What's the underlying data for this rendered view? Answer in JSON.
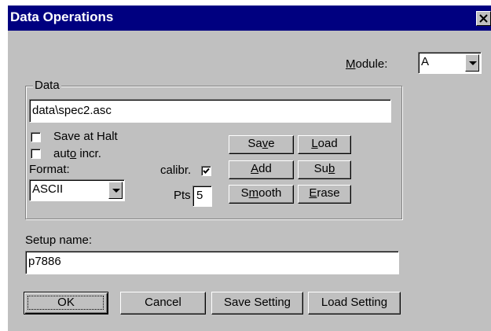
{
  "window": {
    "title": "Data Operations"
  },
  "module": {
    "label": "Module:",
    "value": "A"
  },
  "data_group": {
    "legend": "Data",
    "filename": "data\\spec2.asc",
    "save_at_halt": {
      "label": "Save at Halt",
      "checked": false
    },
    "auto_incr": {
      "label_pre": "aut",
      "label_key": "o",
      "label_post": " incr.",
      "checked": false
    },
    "format": {
      "label": "Format:",
      "value": "ASCII"
    },
    "calibr": {
      "label": "calibr.",
      "checked": true
    },
    "pts": {
      "label": "Pts",
      "value": "5"
    },
    "buttons": {
      "save": {
        "pre": "Sa",
        "key": "v",
        "post": "e"
      },
      "load": {
        "pre": "",
        "key": "L",
        "post": "oad"
      },
      "add": {
        "pre": "",
        "key": "A",
        "post": "dd"
      },
      "sub": {
        "pre": "Su",
        "key": "b",
        "post": ""
      },
      "smooth": {
        "pre": "S",
        "key": "m",
        "post": "ooth"
      },
      "erase": {
        "pre": "",
        "key": "E",
        "post": "rase"
      }
    }
  },
  "setup": {
    "label": "Setup name:",
    "value": "p7886"
  },
  "footer": {
    "ok": "OK",
    "cancel": "Cancel",
    "save_setting": "Save Setting",
    "load_setting": "Load Setting"
  },
  "icons": {
    "close": "close-icon",
    "dropdown": "chevron-down-icon",
    "check": "checkmark-icon"
  }
}
